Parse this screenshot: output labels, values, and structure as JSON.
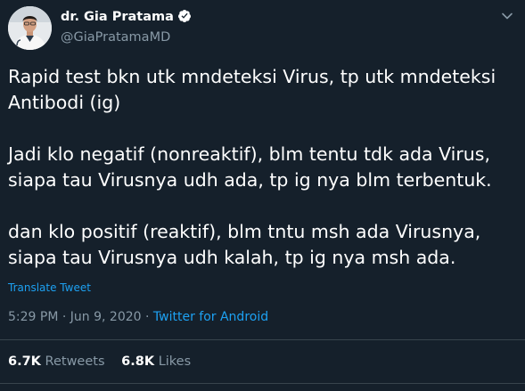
{
  "author": {
    "display_name": "dr. Gia Pratama",
    "handle": "@GiaPratamaMD",
    "avatar": "profile-photo",
    "verified_icon": "verified-badge-icon"
  },
  "menu_icon": "chevron-down-icon",
  "tweet": {
    "lines": [
      "Rapid test bkn utk mndeteksi Virus, tp utk mndeteksi",
      "Antibodi (ig)",
      "",
      "Jadi klo negatif (nonreaktif), blm tentu tdk ada Virus,",
      "siapa tau Virusnya udh ada, tp ig nya blm terbentuk.",
      "",
      "dan klo positif (reaktif), blm tntu msh ada Virusnya,",
      "siapa tau Virusnya udh kalah, tp ig nya msh ada."
    ],
    "translate_label": "Translate Tweet",
    "time": "5:29 PM",
    "date": "Jun 9, 2020",
    "separator_1": "·",
    "separator_2": "·",
    "source": "Twitter for Android"
  },
  "stats": {
    "retweets_count": "6.7K",
    "retweets_label": "Retweets",
    "likes_count": "6.8K",
    "likes_label": "Likes"
  },
  "colors": {
    "background": "#15202b",
    "text": "#ffffff",
    "secondary_text": "#8899a6",
    "link": "#1da1f2",
    "divider": "#38444d"
  }
}
